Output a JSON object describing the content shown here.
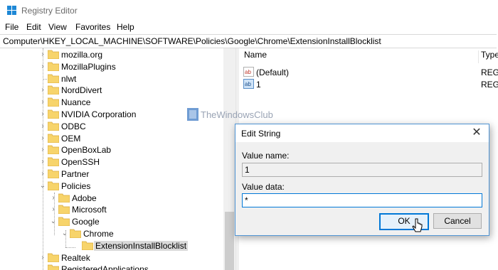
{
  "window": {
    "title": "Registry Editor"
  },
  "menu": [
    "File",
    "Edit",
    "View",
    "Favorites",
    "Help"
  ],
  "address": "Computer\\HKEY_LOCAL_MACHINE\\SOFTWARE\\Policies\\Google\\Chrome\\ExtensionInstallBlocklist",
  "tree": {
    "items": [
      {
        "label": "mozilla.org",
        "level": 0,
        "chevron": ">"
      },
      {
        "label": "MozillaPlugins",
        "level": 0,
        "chevron": ">"
      },
      {
        "label": "nlwt",
        "level": 0,
        "chevron": ""
      },
      {
        "label": "NordDivert",
        "level": 0,
        "chevron": ">"
      },
      {
        "label": "Nuance",
        "level": 0,
        "chevron": ">"
      },
      {
        "label": "NVIDIA Corporation",
        "level": 0,
        "chevron": ">"
      },
      {
        "label": "ODBC",
        "level": 0,
        "chevron": ">"
      },
      {
        "label": "OEM",
        "level": 0,
        "chevron": ">"
      },
      {
        "label": "OpenBoxLab",
        "level": 0,
        "chevron": ">"
      },
      {
        "label": "OpenSSH",
        "level": 0,
        "chevron": ">"
      },
      {
        "label": "Partner",
        "level": 0,
        "chevron": ">"
      },
      {
        "label": "Policies",
        "level": 0,
        "chevron": "v"
      },
      {
        "label": "Adobe",
        "level": 1,
        "chevron": ">"
      },
      {
        "label": "Microsoft",
        "level": 1,
        "chevron": ">"
      },
      {
        "label": "Google",
        "level": 1,
        "chevron": "v"
      },
      {
        "label": "Chrome",
        "level": 2,
        "chevron": "v"
      },
      {
        "label": "ExtensionInstallBlocklist",
        "level": 3,
        "chevron": "",
        "selected": true
      },
      {
        "label": "Realtek",
        "level": 0,
        "chevron": ">"
      },
      {
        "label": "RegisteredApplications",
        "level": 0,
        "chevron": ""
      }
    ]
  },
  "values": {
    "columns": [
      "Name",
      "Type"
    ],
    "rows": [
      {
        "name": "(Default)",
        "type": "REG_",
        "icon": "string-value-icon"
      },
      {
        "name": "1",
        "type": "REG_",
        "icon": "string-value-icon"
      }
    ]
  },
  "watermark": "TheWindowsClub",
  "dialog": {
    "title": "Edit String",
    "value_name_label": "Value name:",
    "value_name": "1",
    "value_data_label": "Value data:",
    "value_data": "*",
    "ok": "OK",
    "cancel": "Cancel"
  }
}
